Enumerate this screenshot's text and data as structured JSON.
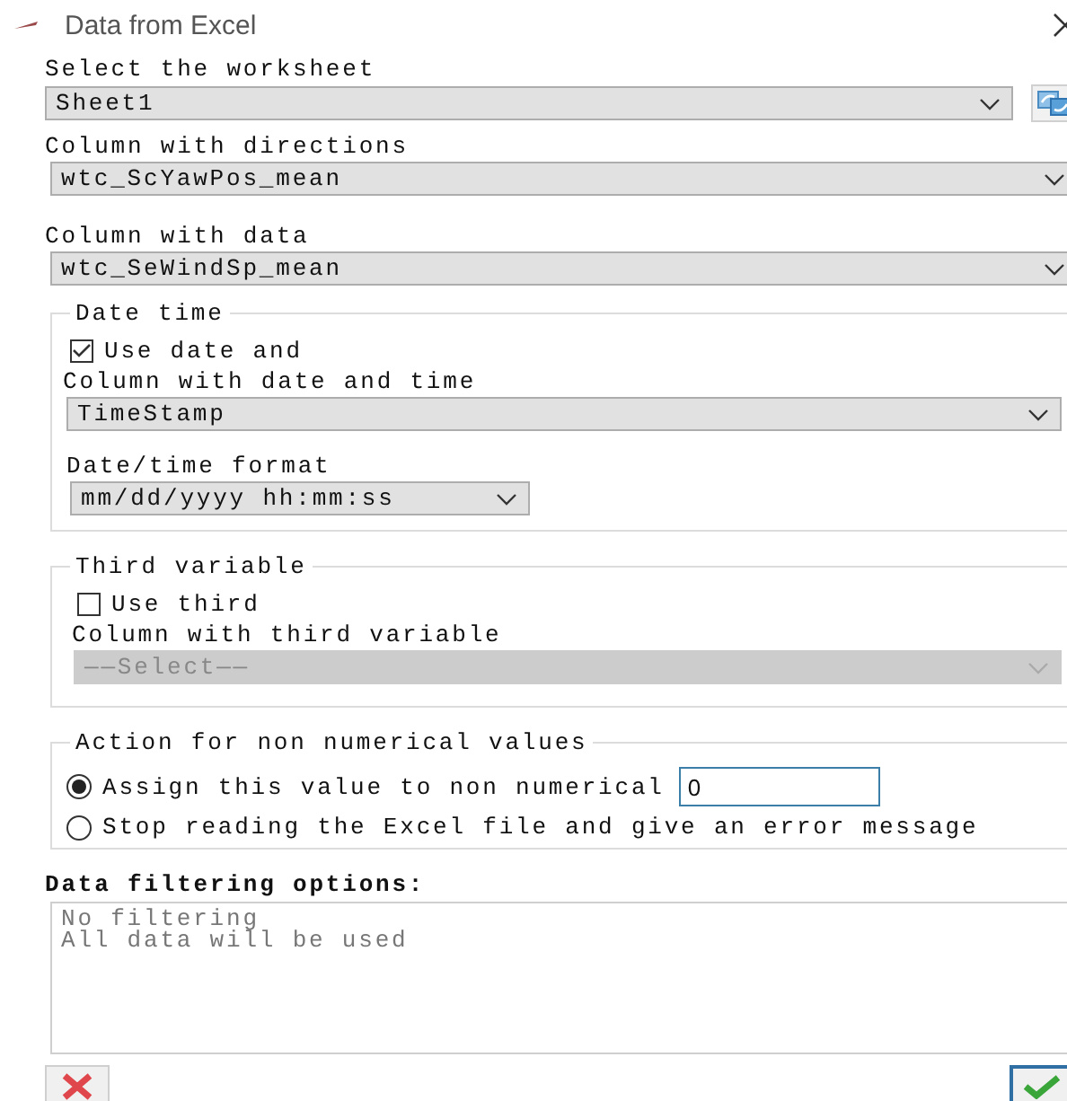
{
  "window": {
    "title": "Data from Excel"
  },
  "worksheet": {
    "label": "Select the worksheet",
    "value": "Sheet1"
  },
  "directions": {
    "label": "Column with directions",
    "value": "wtc_ScYawPos_mean"
  },
  "data_column": {
    "label": "Column with data",
    "value": "wtc_SeWindSp_mean"
  },
  "date_time": {
    "title": "Date time",
    "use": {
      "label": "Use date and",
      "checked": true
    },
    "column": {
      "label": "Column with date and time",
      "value": "TimeStamp"
    },
    "format": {
      "label": "Date/time format",
      "value": "mm/dd/yyyy hh:mm:ss"
    }
  },
  "third_variable": {
    "title": "Third variable",
    "use": {
      "label": "Use third",
      "checked": false
    },
    "column": {
      "label": "Column with third variable",
      "value": "——Select——",
      "disabled": true
    }
  },
  "non_numerical": {
    "title": "Action for non numerical values",
    "options": [
      {
        "label": "Assign this value to non numerical",
        "selected": true
      },
      {
        "label": "Stop reading the Excel file and give an error message",
        "selected": false
      }
    ],
    "assign_value": "0"
  },
  "filtering": {
    "label": "Data filtering options:",
    "lines": [
      "No filtering",
      "All data will be used"
    ]
  }
}
